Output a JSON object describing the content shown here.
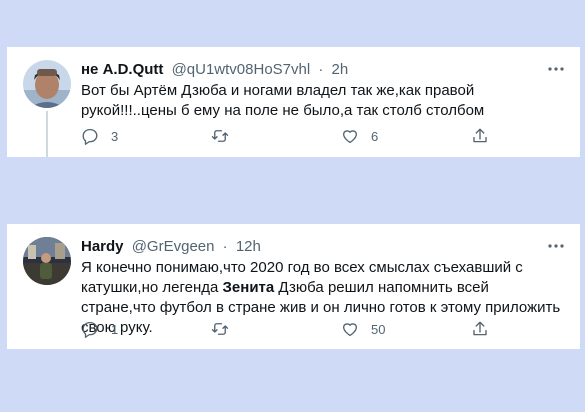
{
  "tweets": [
    {
      "name": "не A.D.Qutt",
      "handle": "@qU1wtv08HoS7vhl",
      "dot": "·",
      "time": "2h",
      "text": "Вот бы Артём Дзюба и ногами владел так же,как правой рукой!!!..цены б ему на поле не было,а так столб столбом",
      "reply_count": "3",
      "retweet_count": "",
      "like_count": "6"
    },
    {
      "name": "Hardy",
      "handle": "@GrEvgeen",
      "dot": "·",
      "time": "12h",
      "text_before": "Я конечно понимаю,что 2020 год во всех смыслах съехавший с катушки,но легенда ",
      "text_bold": "Зенита",
      "text_after": " Дзюба решил напомнить всей стране,что футбол в стране жив и он лично готов к этому приложить свою руку.",
      "reply_count": "1",
      "retweet_count": "",
      "like_count": "50"
    }
  ],
  "icons": {
    "more": "more-dots-icon",
    "reply": "reply-icon",
    "retweet": "retweet-icon",
    "like": "heart-icon",
    "share": "share-icon"
  },
  "colors": {
    "background": "#cfdaf7",
    "card": "#ffffff",
    "text": "#0f1419",
    "secondary": "#536471"
  }
}
